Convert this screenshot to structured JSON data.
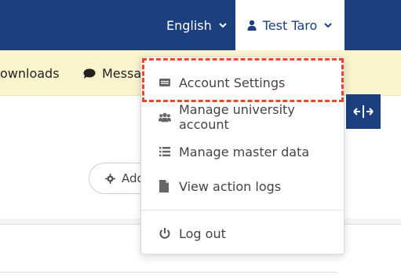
{
  "header": {
    "language_label": "English",
    "user_label": "Test Taro"
  },
  "subnav": {
    "downloads_label": "ownloads",
    "messages_label": "Messag"
  },
  "main": {
    "add_button_label": "Add"
  },
  "dropdown": {
    "items": [
      {
        "label": "Account Settings",
        "icon": "id-card-icon"
      },
      {
        "label": "Manage university account",
        "icon": "users-icon"
      },
      {
        "label": "Manage master data",
        "icon": "list-icon"
      },
      {
        "label": "View action logs",
        "icon": "file-icon"
      },
      {
        "label": "Log out",
        "icon": "power-icon"
      }
    ],
    "highlighted_item": "Account Settings"
  },
  "colors": {
    "header_bg": "#1c3f80",
    "subnav_bg": "#faf3cc",
    "highlight_border": "#e8492b"
  }
}
